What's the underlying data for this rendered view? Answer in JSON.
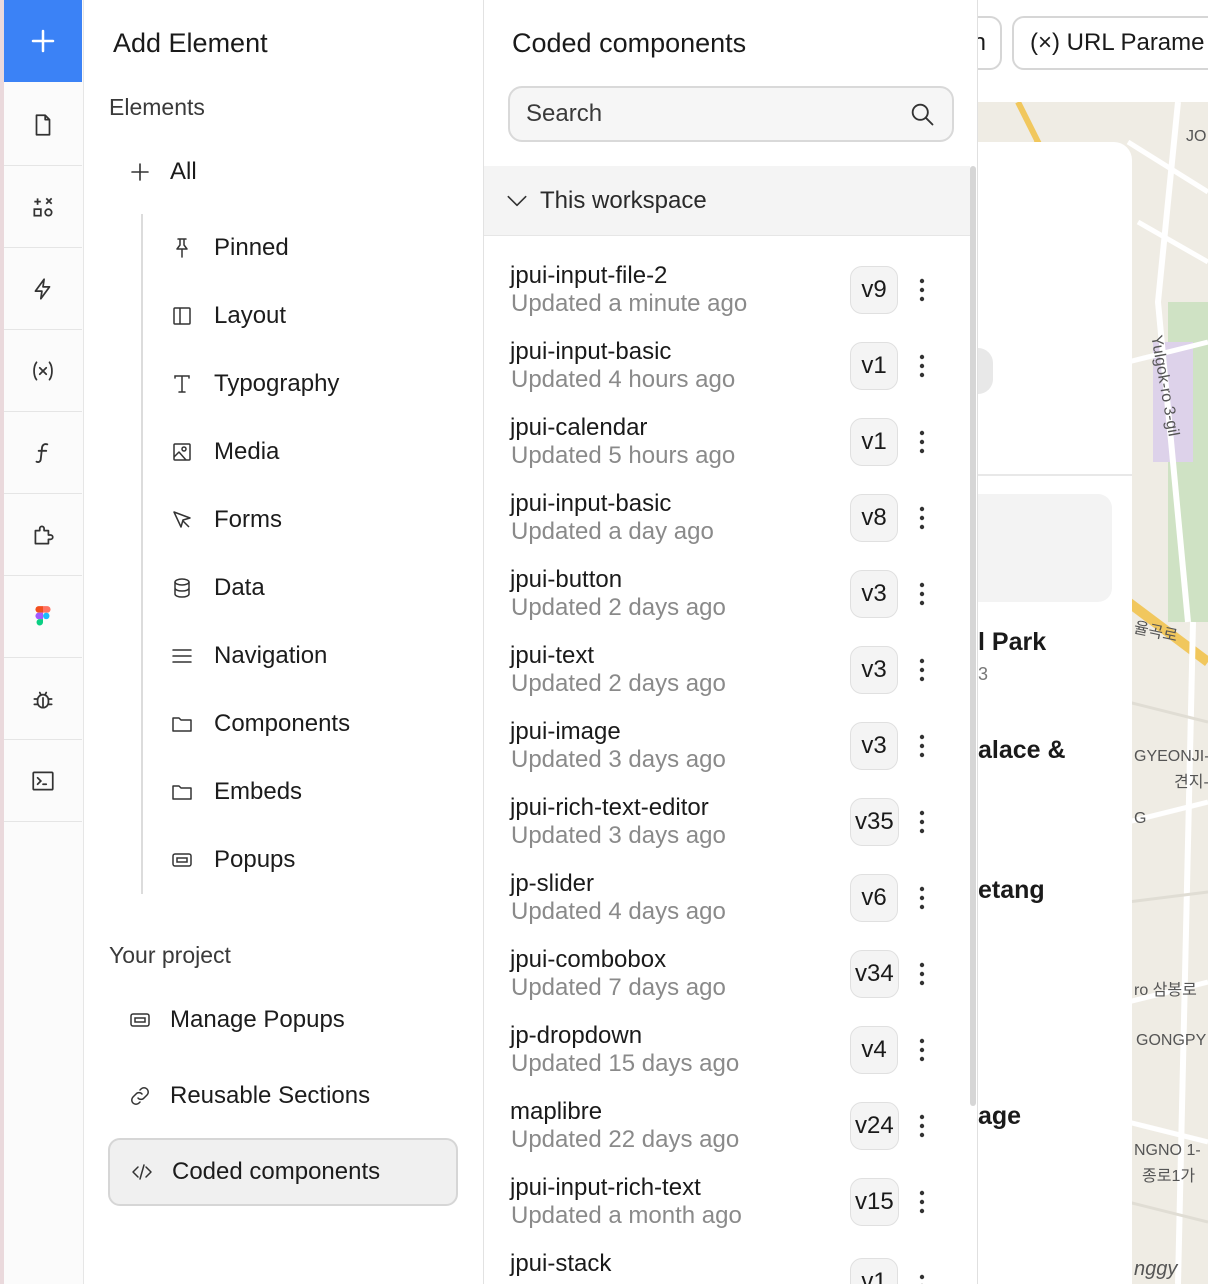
{
  "rail": {
    "items": [
      {
        "name": "add-button",
        "icon": "plus-icon"
      },
      {
        "name": "pages-button",
        "icon": "file-icon"
      },
      {
        "name": "widgets-button",
        "icon": "shapes-icon"
      },
      {
        "name": "interactions-button",
        "icon": "lightning-icon"
      },
      {
        "name": "variables-button",
        "icon": "variable-icon"
      },
      {
        "name": "functions-button",
        "icon": "function-icon"
      },
      {
        "name": "plugins-button",
        "icon": "puzzle-icon"
      },
      {
        "name": "figma-button",
        "icon": "figma-icon"
      },
      {
        "name": "debug-button",
        "icon": "bug-icon"
      },
      {
        "name": "terminal-button",
        "icon": "terminal-icon"
      }
    ],
    "accent": "#3b82f6"
  },
  "elements_panel": {
    "title": "Add Element",
    "elements_label": "Elements",
    "all_label": "All",
    "categories": [
      {
        "label": "Pinned",
        "icon": "pin-icon"
      },
      {
        "label": "Layout",
        "icon": "layout-icon"
      },
      {
        "label": "Typography",
        "icon": "typography-icon"
      },
      {
        "label": "Media",
        "icon": "image-icon"
      },
      {
        "label": "Forms",
        "icon": "cursor-icon"
      },
      {
        "label": "Data",
        "icon": "database-icon"
      },
      {
        "label": "Navigation",
        "icon": "menu-icon"
      },
      {
        "label": "Components",
        "icon": "folder-icon"
      },
      {
        "label": "Embeds",
        "icon": "folder-icon"
      },
      {
        "label": "Popups",
        "icon": "popup-icon"
      }
    ],
    "project_label": "Your project",
    "project_items": [
      {
        "label": "Manage Popups",
        "icon": "popup-icon"
      },
      {
        "label": "Reusable Sections",
        "icon": "link-icon"
      },
      {
        "label": "Coded components",
        "icon": "code-icon"
      }
    ]
  },
  "coded_panel": {
    "title": "Coded components",
    "search_placeholder": "Search",
    "workspace_label": "This workspace",
    "components": [
      {
        "name": "jpui-input-file-2",
        "updated": "Updated a minute ago",
        "version": "v9"
      },
      {
        "name": "jpui-input-basic",
        "updated": "Updated 4 hours ago",
        "version": "v1"
      },
      {
        "name": "jpui-calendar",
        "updated": "Updated 5 hours ago",
        "version": "v1"
      },
      {
        "name": "jpui-input-basic",
        "updated": "Updated a day ago",
        "version": "v8"
      },
      {
        "name": "jpui-button",
        "updated": "Updated 2 days ago",
        "version": "v3"
      },
      {
        "name": "jpui-text",
        "updated": "Updated 2 days ago",
        "version": "v3"
      },
      {
        "name": "jpui-image",
        "updated": "Updated 3 days ago",
        "version": "v3"
      },
      {
        "name": "jpui-rich-text-editor",
        "updated": "Updated 3 days ago",
        "version": "v35"
      },
      {
        "name": "jp-slider",
        "updated": "Updated 4 days ago",
        "version": "v6"
      },
      {
        "name": "jpui-combobox",
        "updated": "Updated 7 days ago",
        "version": "v34"
      },
      {
        "name": "jp-dropdown",
        "updated": "Updated 15 days ago",
        "version": "v4"
      },
      {
        "name": "maplibre",
        "updated": "Updated 22 days ago",
        "version": "v24"
      },
      {
        "name": "jpui-input-rich-text",
        "updated": "Updated a month ago",
        "version": "v15"
      },
      {
        "name": "jpui-stack",
        "updated": "",
        "version": "v1"
      }
    ]
  },
  "background": {
    "tab_partial": "n",
    "tab_url_params": "(×) URL Parame",
    "card_texts": [
      "l Park",
      "3",
      "alace &",
      "etang",
      "age"
    ],
    "map_labels": [
      "JO",
      "Yulgok-ro 3-gil",
      "율곡로",
      "GYEONJI-",
      "견지-",
      "G",
      "ro 삼봉로",
      "GONGPY",
      "NGNO 1-",
      "종로1가",
      "nggy"
    ]
  }
}
